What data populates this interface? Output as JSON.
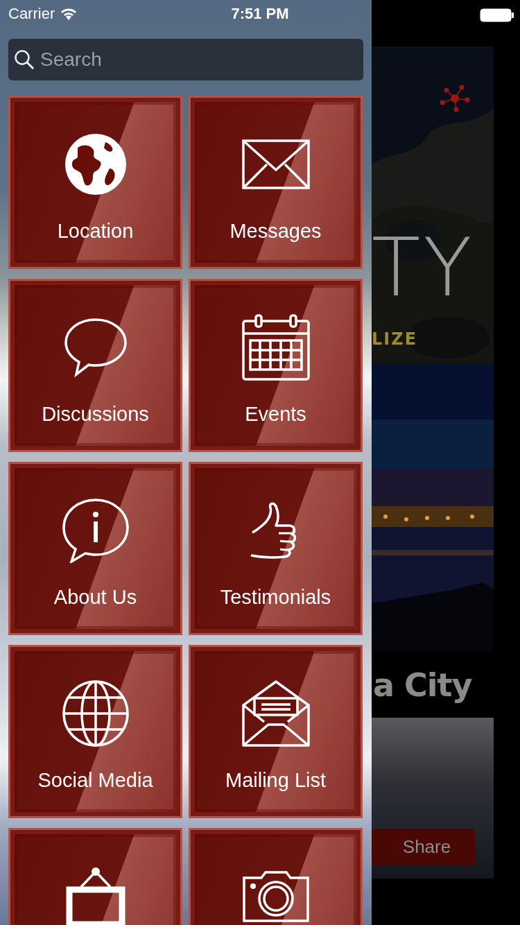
{
  "status_bar": {
    "carrier": "Carrier",
    "time": "7:51 PM"
  },
  "search": {
    "placeholder": "Search"
  },
  "tiles": [
    {
      "label": "Location",
      "kind": "globe"
    },
    {
      "label": "Messages",
      "kind": "envelope"
    },
    {
      "label": "Discussions",
      "kind": "bubble"
    },
    {
      "label": "Events",
      "kind": "calendar"
    },
    {
      "label": "About Us",
      "kind": "info"
    },
    {
      "label": "Testimonials",
      "kind": "thumb"
    },
    {
      "label": "Social Media",
      "kind": "wireglobe"
    },
    {
      "label": "Mailing List",
      "kind": "openmail"
    },
    {
      "kind": "frame"
    },
    {
      "kind": "camera"
    }
  ],
  "background_screen": {
    "banner_title": "TY",
    "banner_tagline": "LIZE",
    "heading": "a City",
    "share_button": "Share"
  }
}
